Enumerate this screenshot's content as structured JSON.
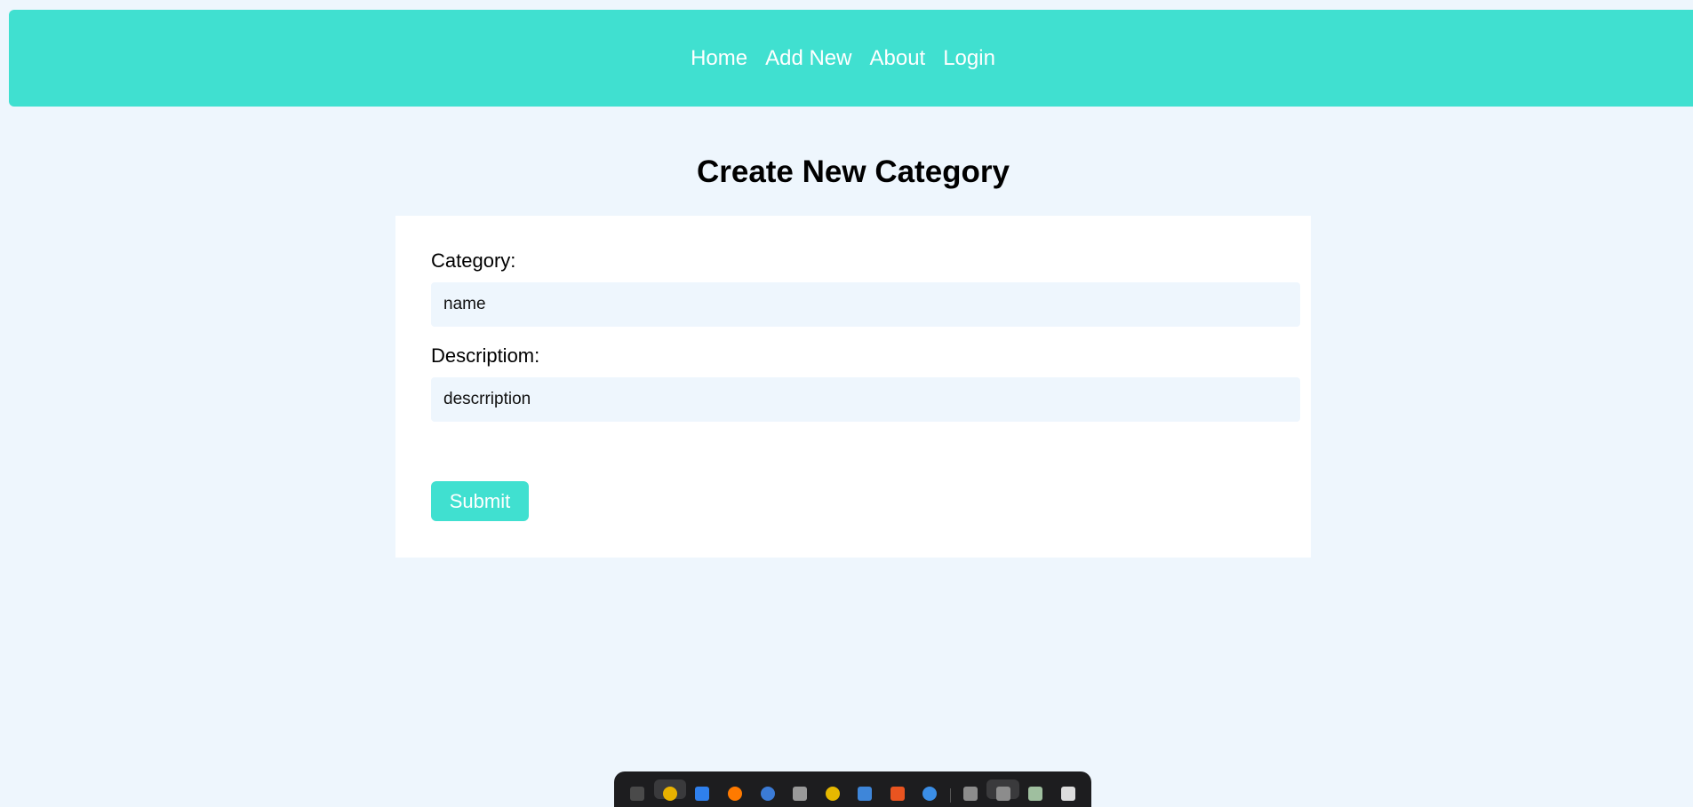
{
  "nav": {
    "links": [
      "Home",
      "Add New",
      "About",
      "Login"
    ]
  },
  "page": {
    "title": "Create New Category"
  },
  "form": {
    "category_label": "Category:",
    "category_placeholder": "name",
    "description_label": "Descriptiom:",
    "description_placeholder": "descrription",
    "submit_label": "Submit"
  },
  "colors": {
    "accent": "#40e0d0",
    "background": "#eef6fd",
    "card": "#ffffff"
  },
  "dock": {
    "icons": [
      {
        "name": "terminal-icon",
        "color": "#4a4a4a"
      },
      {
        "name": "chrome-icon",
        "color": "#e8b100"
      },
      {
        "name": "vscode-icon",
        "color": "#2f80ed"
      },
      {
        "name": "firefox-icon",
        "color": "#ff7a00"
      },
      {
        "name": "thunderbird-icon",
        "color": "#3b7bd6"
      },
      {
        "name": "files-icon",
        "color": "#9a9a9a"
      },
      {
        "name": "rhythmbox-icon",
        "color": "#e6b800"
      },
      {
        "name": "writer-icon",
        "color": "#3e86d9"
      },
      {
        "name": "software-icon",
        "color": "#e95420"
      },
      {
        "name": "help-icon",
        "color": "#3b8ee6"
      },
      {
        "name": "drive-icon",
        "color": "#8c8c8c"
      },
      {
        "name": "drive-icon-2",
        "color": "#8c8c8c"
      },
      {
        "name": "trash-icon",
        "color": "#9fbf9f"
      },
      {
        "name": "app-grid-icon",
        "color": "#dddddd"
      }
    ]
  }
}
